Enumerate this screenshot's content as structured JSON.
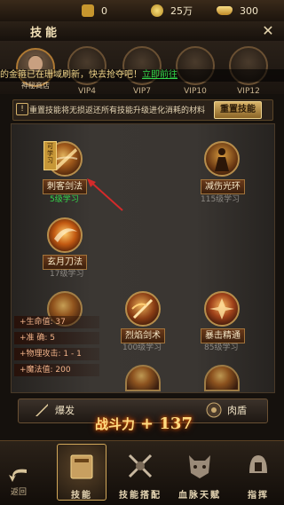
{
  "resources": [
    {
      "icon": "fuel-can-icon",
      "value": "0",
      "color": "#d5a53c"
    },
    {
      "icon": "coin-icon",
      "value": "25万",
      "color": "#e7c24a"
    },
    {
      "icon": "gold-ingot-icon",
      "value": "300",
      "color": "#f0c55a"
    }
  ],
  "header": {
    "title": "技能",
    "close": "✕"
  },
  "vip_tiers": [
    "VIP4",
    "VIP7",
    "VIP10",
    "VIP12"
  ],
  "avatar_label": "神秘商店",
  "marquee": {
    "text": "的金箍已在珊域刷新，快去抢夺吧！",
    "link": "立即前往"
  },
  "info": {
    "text": "重置技能将无损返还所有技能升级进化消耗的材料",
    "reset_label": "重置技能"
  },
  "skills": [
    {
      "name": "刺客剑法",
      "level": "5级学习",
      "tag": "可学习",
      "learnable": true
    },
    {
      "name": "减伤光环",
      "level": "115级学习",
      "learnable": false
    },
    {
      "name": "玄月刀法",
      "level": "17级学习",
      "learnable": false
    },
    {
      "name": "烈焰剑术",
      "level": "100级学习",
      "learnable": false
    },
    {
      "name": "暴击精通",
      "level": "85级学习",
      "learnable": false
    }
  ],
  "stats": [
    "+生命值: 37",
    "+准 确: 5",
    "+物理攻击: 1 - 1",
    "+魔法值: 200"
  ],
  "actions": {
    "left": "爆发",
    "right": "肉盾"
  },
  "power": {
    "label": "战斗力",
    "value": "+ 137"
  },
  "nav": {
    "back": "返回",
    "items": [
      "技能",
      "技能搭配",
      "血脉天赋",
      "指挥"
    ],
    "active": 0
  }
}
